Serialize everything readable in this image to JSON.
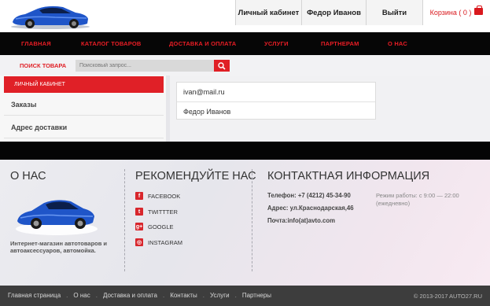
{
  "header": {
    "cabinet_label": "Личный кабинет",
    "user_name": "Федор Иванов",
    "logout_label": "Выйти",
    "cart_label": "Корзина ( 0 )",
    "cart_icon": "shopping-bag-icon",
    "logo_icon": "car-logo-icon"
  },
  "nav": {
    "items": [
      "ГЛАВНАЯ",
      "КАТАЛОГ ТОВАРОВ",
      "ДОСТАВКА И ОПЛАТА",
      "УСЛУГИ",
      "ПАРТНЕРАМ",
      "О НАС"
    ]
  },
  "search": {
    "label": "ПОИСК ТОВАРА",
    "placeholder": "Поисковый запрос...",
    "button_icon": "search-icon"
  },
  "sidebar": {
    "header": "ЛИЧНЫЙ КАБИНЕТ",
    "items": [
      "Заказы",
      "Адрес доставки"
    ]
  },
  "profile": {
    "email": "ivan@mail.ru",
    "name": "Федор Иванов"
  },
  "footer": {
    "about_title": "О НАС",
    "about_text": "Интернет-магазин автотоваров и автоаксессуаров, автомойка.",
    "recommend_title": "РЕКОМЕНДУЙТЕ НАС",
    "social": [
      {
        "label": "FACEBOOK",
        "icon": "facebook-icon",
        "glyph": "f"
      },
      {
        "label": "TWITTTER",
        "icon": "twitter-icon",
        "glyph": "t"
      },
      {
        "label": "GOOGLE",
        "icon": "google-plus-icon",
        "glyph": "g+"
      },
      {
        "label": "INSTAGRAM",
        "icon": "instagram-icon",
        "glyph": "◎"
      }
    ],
    "contact_title": "КОНТАКТНАЯ ИНФОРМАЦИЯ",
    "phone": "Телефон: +7 (4212) 45-34-90",
    "address": "Адрес: ул.Краснодарская,46",
    "email": "Почта:info(at)avto.com",
    "hours": "Режим работы: с 9:00 — 22:00 (ежедневно)"
  },
  "bottom": {
    "links": [
      "Главная страница",
      "О нас",
      "Доставка и оплата",
      "Контакты",
      "Услуги",
      "Партнеры"
    ],
    "separator": ".",
    "copyright": "© 2013-2017 AUTO27.RU"
  },
  "colors": {
    "accent": "#e02027",
    "nav_bg": "#060606",
    "footer_bar": "#3d3d3d"
  }
}
